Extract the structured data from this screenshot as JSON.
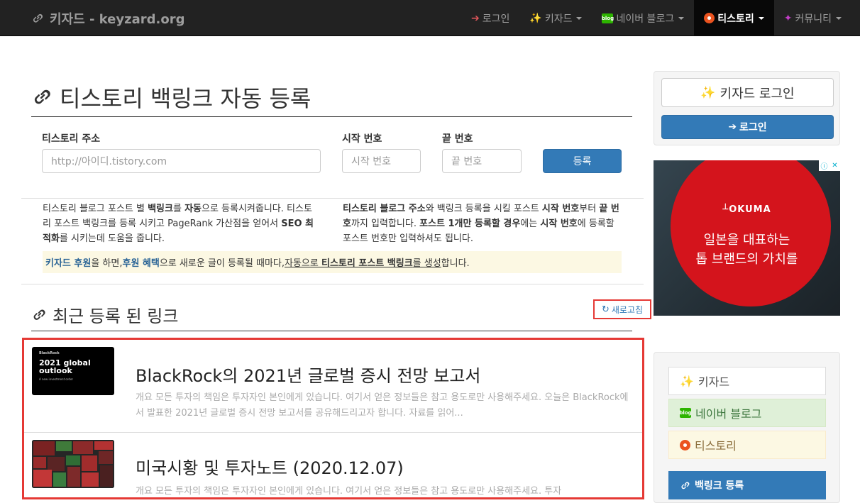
{
  "brand": {
    "title": "키자드 - keyzard.org"
  },
  "nav": {
    "items": [
      {
        "label": "로그인",
        "icon": "sign-in-icon"
      },
      {
        "label": "키자드",
        "icon": "magic-wand-icon",
        "dropdown": true
      },
      {
        "label": "네이버 블로그",
        "icon": "naver-blog-icon",
        "dropdown": true
      },
      {
        "label": "티스토리",
        "icon": "tistory-icon",
        "dropdown": true,
        "active": true
      },
      {
        "label": "커뮤니티",
        "icon": "satellite-icon",
        "dropdown": true
      }
    ]
  },
  "page": {
    "title": "티스토리 백링크 자동 등록"
  },
  "form": {
    "address_label": "티스토리 주소",
    "address_placeholder": "http://아이디.tistory.com",
    "start_label": "시작 번호",
    "start_placeholder": "시작 번호",
    "end_label": "끝 번호",
    "end_placeholder": "끝 번호",
    "submit_label": "등록"
  },
  "desc": {
    "left": [
      {
        "t": " 티스토리 블로그 포스트 별 ",
        "b": false
      },
      {
        "t": "백링크",
        "b": true
      },
      {
        "t": "를 ",
        "b": false
      },
      {
        "t": "자동",
        "b": true
      },
      {
        "t": "으로 등록시켜줍니다. 티스토리 포스트 백링크를 등록 시키고 PageRank 가산점을 얻어서 ",
        "b": false
      },
      {
        "t": "SEO 최적화",
        "b": true
      },
      {
        "t": "를 시키는데 도움을 줍니다.",
        "b": false
      }
    ],
    "right": [
      {
        "t": " ",
        "b": false
      },
      {
        "t": "티스토리 블로그 주소",
        "b": true
      },
      {
        "t": "와 백링크 등록을 시킬 포스트 ",
        "b": false
      },
      {
        "t": "시작 번호",
        "b": true
      },
      {
        "t": "부터 ",
        "b": false
      },
      {
        "t": "끝 번호",
        "b": true
      },
      {
        "t": "까지 입력합니다. ",
        "b": false
      },
      {
        "t": "포스트 1개만 등록할 경우",
        "b": true
      },
      {
        "t": "에는 ",
        "b": false
      },
      {
        "t": "시작 번호",
        "b": true
      },
      {
        "t": "에 등록할 포스트 번호만 입력하셔도 됩니다.",
        "b": false
      }
    ]
  },
  "notice": {
    "p1": "키자드 후원",
    "p2": "을 하면, ",
    "p3": "후원 혜택",
    "p4": "으로 새로운 글이 등록될 때마다, ",
    "p5a": "자동으로 ",
    "p5b": "티스토리 포스트 백링크",
    "p5c": "를 생성",
    "p6": "합니다."
  },
  "recent": {
    "title": "최근 등록 된 링크",
    "refresh_label": "새로고침",
    "posts": [
      {
        "title": "BlackRock의 2021년 글로벌 증시 전망 보고서",
        "excerpt": "개요 모든 투자의 책임은 투자자인 본인에게 있습니다. 여기서 얻은 정보들은 참고 용도로만 사용해주세요. 오늘은 BlackRock에서 발표한 2021년 글로벌 증시 전망 보고서를 공유해드리고자 합니다. 자료를 읽어...",
        "thumb": {
          "brand": "BlackRock",
          "headline": "2021 global outlook",
          "sub": "A new investment order"
        }
      },
      {
        "title": "미국시황 및 투자노트 (2020.12.07)",
        "excerpt": "개요 모든 투자의 책임은 투자자인 본인에게 있습니다. 여기서 얻은 정보들은 참고 용도로만 사용해주세요. 투자"
      }
    ]
  },
  "sidebar": {
    "login_title": "키자드 로그인",
    "login_button": "로그인",
    "ad": {
      "brand": "OKUMA",
      "line1": "일본을 대표하는",
      "line2": "톱 브랜드의 가치를"
    },
    "menu": [
      {
        "label": "키자드",
        "icon": "magic-wand-icon"
      },
      {
        "label": "네이버 블로그",
        "icon": "naver-blog-icon"
      },
      {
        "label": "티스토리",
        "icon": "tistory-icon"
      },
      {
        "label": "백링크 등록",
        "icon": "link-icon"
      }
    ]
  },
  "colors": {
    "navbar": "#222222",
    "primary": "#337ab7",
    "highlight_border": "#e53935",
    "naver_green": "#2db400",
    "tistory_orange": "#eb531f"
  }
}
